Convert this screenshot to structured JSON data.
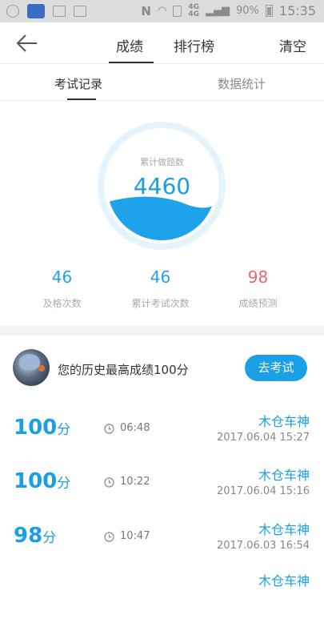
{
  "status_bar": {
    "network_top": "4G",
    "network_bottom": "4G",
    "battery": "90%",
    "time": "15:35"
  },
  "header": {
    "tabs": [
      {
        "label": "成绩"
      },
      {
        "label": "排行榜"
      }
    ],
    "clear_label": "清空"
  },
  "sub_tabs": [
    {
      "label": "考试记录"
    },
    {
      "label": "数据统计"
    }
  ],
  "summary": {
    "label": "累计做题数",
    "value": "4460",
    "fill_fraction": 0.35
  },
  "stats": [
    {
      "value": "46",
      "label": "及格次数"
    },
    {
      "value": "46",
      "label": "累计考试次数"
    },
    {
      "value": "98",
      "label": "成绩预测"
    }
  ],
  "best": {
    "text": "您的历史最高成绩100分",
    "button": "去考试"
  },
  "records": [
    {
      "score": "100",
      "unit": "分",
      "duration": "06:48",
      "name": "木仓车神",
      "date": "2017.06.04  15:27"
    },
    {
      "score": "100",
      "unit": "分",
      "duration": "10:22",
      "name": "木仓车神",
      "date": "2017.06.04  15:16"
    },
    {
      "score": "98",
      "unit": "分",
      "duration": "10:47",
      "name": "木仓车神",
      "date": "2017.06.03  16:54"
    },
    {
      "name": "木仓车神"
    }
  ],
  "colors": {
    "accent": "#1aa0e6",
    "prediction": "#e46a6a"
  }
}
